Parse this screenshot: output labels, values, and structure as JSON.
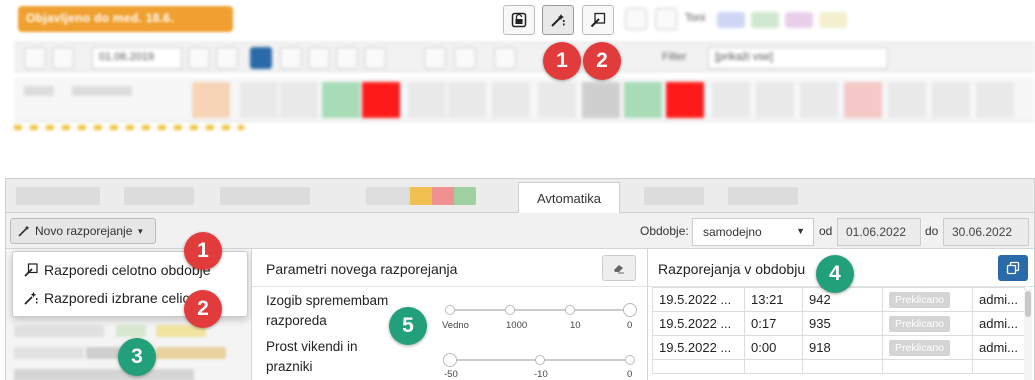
{
  "top": {
    "banner_text": "Objavljeno do med. 18.6.",
    "date": "01.06.2019",
    "filter_label": "Filter",
    "filter_value": "[prikaži vse]",
    "tone_label": "Toni"
  },
  "tabs": {
    "active": "Avtomatika"
  },
  "toolbar2": {
    "new_schedule_label": "Novo razporejanje",
    "period_label": "Obdobje:",
    "period_value": "samodejno",
    "from_label": "od",
    "from_date": "01.06.2022",
    "to_label": "do",
    "to_date": "30.06.2022"
  },
  "menu": {
    "item1": "Razporedi celotno obdobje",
    "item2": "Razporedi izbrane celice"
  },
  "params": {
    "title": "Parametri novega razporejanja",
    "p1_label_line1": "Izogib spremembam",
    "p1_label_line2": "razporeda",
    "p1_ticks": [
      "Vedno",
      "1000",
      "10",
      "0"
    ],
    "p2_label_line1": "Prost vikendi in",
    "p2_label_line2": "prazniki",
    "p2_ticks": [
      "-50",
      "-10",
      "0"
    ]
  },
  "schedules": {
    "title": "Razporejanja v obdobju",
    "rows": [
      {
        "date": "19.5.2022 ...",
        "time": "13:21",
        "id": "942",
        "status": "Preklicano",
        "user": "admi..."
      },
      {
        "date": "19.5.2022 ...",
        "time": "0:17",
        "id": "935",
        "status": "Preklicano",
        "user": "admi..."
      },
      {
        "date": "19.5.2022 ...",
        "time": "0:00",
        "id": "918",
        "status": "Preklicano",
        "user": "admi..."
      }
    ]
  },
  "badges": {
    "b1": "1",
    "b2": "2",
    "b3": "3",
    "b4": "4",
    "b5": "5"
  },
  "colors": {
    "badge_red": "#e23b3b",
    "badge_green": "#22a07a",
    "accent_blue": "#2a6aa8",
    "orange": "#f0a030"
  }
}
